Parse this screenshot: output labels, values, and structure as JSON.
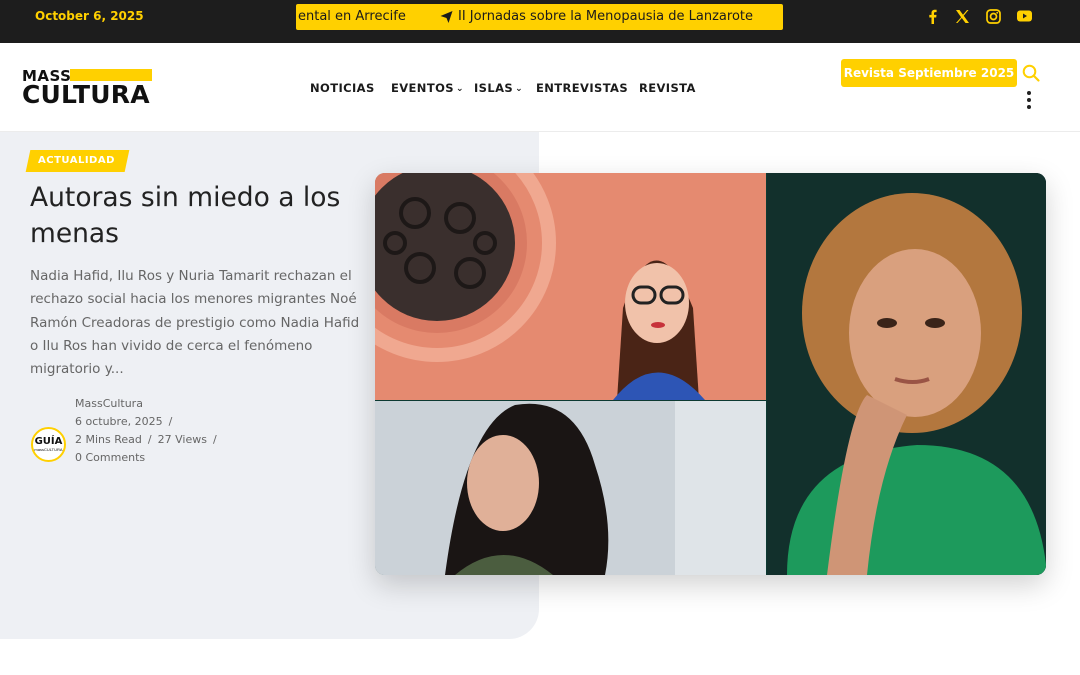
{
  "topbar": {
    "date": "October 6, 2025",
    "ticker_items": [
      "ental en Arrecife",
      "II Jornadas sobre la Menopausia de Lanzarote"
    ],
    "social_icons": [
      "facebook-icon",
      "x-icon",
      "instagram-icon",
      "youtube-icon"
    ]
  },
  "header": {
    "logo_top": "MASS",
    "logo_bottom": "CULTURA",
    "nav": [
      "NOTICIAS",
      "EVENTOS",
      "ISLAS",
      "ENTREVISTAS",
      "REVISTA"
    ],
    "revista_button": "Revista Septiembre 2025"
  },
  "hero": {
    "tag": "ACTUALIDAD",
    "title": "Autoras sin miedo a los menas",
    "excerpt": "Nadia Hafid, Ilu Ros y Nuria Tamarit rechazan el rechazo social hacia los menores migrantes Noé Ramón Creadoras de prestigio como Nadia Hafid o Ilu Ros han vivido de cerca el fenómeno migratorio y...",
    "author": "MassCultura",
    "avatar_text": "GUÍA",
    "avatar_subtext": "massCULTURA",
    "date": "6 octubre, 2025",
    "read_time": "2 Mins Read",
    "views": "27 Views",
    "comments": "0 Comments"
  },
  "colors": {
    "accent": "#ffd000",
    "topbar_bg": "#1d1d1d",
    "hero_bg": "#eef0f4"
  }
}
